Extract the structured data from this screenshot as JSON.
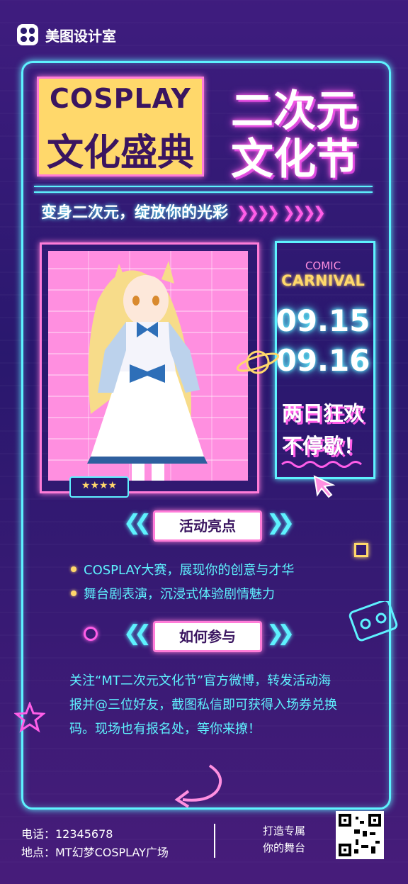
{
  "brand": {
    "name": "美图设计室"
  },
  "title": {
    "left_line1": "COSPLAY",
    "left_line2": "文化盛典",
    "right_line1": "二次元",
    "right_line2": "文化节"
  },
  "subtitle": "变身二次元，绽放你的光彩",
  "side": {
    "comic": "COMIC",
    "carnival": "CARNIVAL",
    "date1": "09.15",
    "date2": "09.16",
    "slogan1": "两日狂欢",
    "slogan2": "不停歇！"
  },
  "badge_stars": "★★★★",
  "sections": {
    "highlights": "活动亮点",
    "how_to_join": "如何参与"
  },
  "highlights": [
    "COSPLAY大赛，展现你的创意与才华",
    "舞台剧表演，沉浸式体验剧情魅力"
  ],
  "join_text": "关注“MT二次元文化节”官方微博，转发活动海报并@三位好友，截图私信即可获得入场券兑换码。现场也有报名处，等你来撩！",
  "footer": {
    "phone": "电话：12345678",
    "address": "地点：MT幻梦COSPLAY广场",
    "tagline_1": "打造专属",
    "tagline_2": "你的舞台"
  },
  "colors": {
    "cyan": "#5ef2ff",
    "pink": "#ff5ee8",
    "yellow": "#ffd86b",
    "bg": "#2a1a6e"
  },
  "icons": [
    "logo-icon",
    "planet-icon",
    "cursor-icon",
    "star-icon",
    "cassette-icon",
    "qr-code",
    "return-arrow-icon"
  ]
}
